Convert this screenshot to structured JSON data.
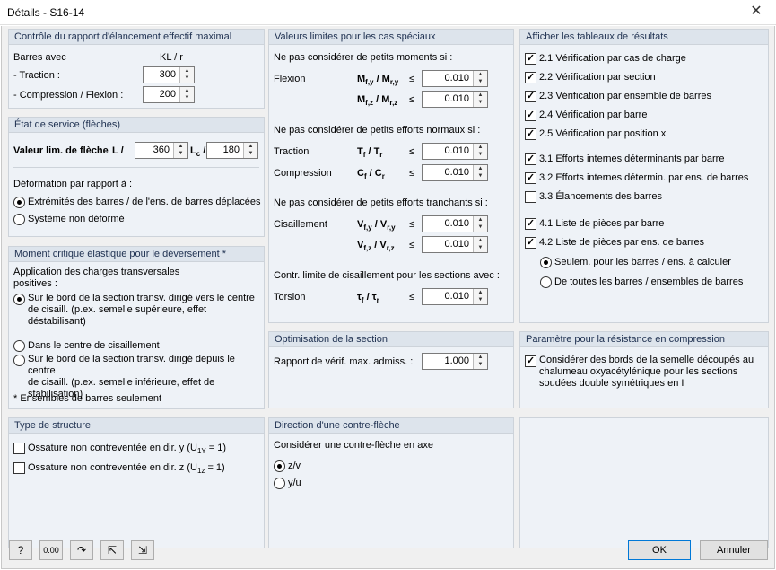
{
  "window": {
    "title": "Détails - S16-14",
    "close": "✕"
  },
  "slenderness": {
    "header": "Contrôle du rapport d'élancement effectif maximal",
    "col1": "Barres avec",
    "col2": "KL / r",
    "traction_label": "- Traction :",
    "traction_value": "300",
    "compression_label": "- Compression / Flexion :",
    "compression_value": "200"
  },
  "service": {
    "header": "État de service (flèches)",
    "limit_label": "Valeur lim. de flèche",
    "l_label": "L /",
    "l_value": "360",
    "lc_label": "L",
    "lc_sub": "c",
    "lc_slash": "/",
    "lc_value": "180",
    "deformation_label": "Déformation par rapport à :",
    "opt1": "Extrémités des barres / de l'ens. de barres déplacées",
    "opt2": "Système non déformé"
  },
  "moment": {
    "header": "Moment critique élastique pour le déversement *",
    "intro": "Application des charges transversales\npositives :",
    "opt1": "Sur le bord de la section transv. dirigé vers le centre\nde cisaill. (p.ex. semelle supérieure, effet\ndéstabilisant)",
    "opt2": "Dans le centre de cisaillement",
    "opt3": "Sur le bord de la section transv. dirigé depuis le centre\nde cisaill. (p.ex. semelle inférieure, effet de\nstabilisation)",
    "note": "* Ensembles de barres seulement"
  },
  "structure": {
    "header": "Type de structure",
    "opt1": "Ossature non contreventée en dir. y (U",
    "opt1_sub": "1Y",
    "opt1_end": " = 1)",
    "opt2": "Ossature non contreventée en dir. z (U",
    "opt2_sub": "1z",
    "opt2_end": " = 1)"
  },
  "limits": {
    "header": "Valeurs limites pour les cas spéciaux",
    "moments_title": "Ne pas considérer de petits moments si :",
    "flexion": "Flexion",
    "my_formula": "M",
    "my_sub1": "f,y",
    "my_mid": " / M",
    "my_sub2": "r,y",
    "my_value": "0.010",
    "mz_formula": "M",
    "mz_sub1": "f,z",
    "mz_mid": " / M",
    "mz_sub2": "r,z",
    "mz_value": "0.010",
    "normal_title": "Ne pas considérer de petits efforts normaux si :",
    "traction": "Traction",
    "t_formula": "T",
    "t_sub1": "f",
    "t_mid": " / T",
    "t_sub2": "r",
    "t_value": "0.010",
    "compression": "Compression",
    "c_formula": "C",
    "c_sub1": "f",
    "c_mid": " / C",
    "c_sub2": "r",
    "c_value": "0.010",
    "shear_title": "Ne pas considérer de petits efforts tranchants si :",
    "cisaillement": "Cisaillement",
    "vy_formula": "V",
    "vy_sub1": "f,y",
    "vy_mid": " / V",
    "vy_sub2": "r,y",
    "vy_value": "0.010",
    "vz_formula": "V",
    "vz_sub1": "f,z",
    "vz_mid": " / V",
    "vz_sub2": "r,z",
    "vz_value": "0.010",
    "torsion_title": "Contr. limite de cisaillement pour les sections avec :",
    "torsion": "Torsion",
    "tau_formula": "τ",
    "tau_sub1": "f",
    "tau_mid": " / τ",
    "tau_sub2": "r",
    "tau_value": "0.010",
    "le": "≤"
  },
  "optim": {
    "header": "Optimisation de la section",
    "label": "Rapport de vérif. max. admiss. :",
    "value": "1.000"
  },
  "camber": {
    "header": "Direction d'une contre-flèche",
    "label": "Considérer une contre-flèche en axe",
    "opt1": "z/v",
    "opt2": "y/u"
  },
  "results": {
    "header": "Afficher les tableaux de résultats",
    "items": [
      "2.1 Vérification par cas de charge",
      "2.2 Vérification par section",
      "2.3 Vérification par ensemble de barres",
      "2.4 Vérification par barre",
      "2.5 Vérification par position x",
      "3.1 Efforts internes déterminants par barre",
      "3.2 Efforts internes détermin. par ens. de barres",
      "3.3 Élancements des barres",
      "4.1 Liste de pièces par barre",
      "4.2 Liste de pièces par ens. de barres"
    ],
    "radio1": "Seulem. pour les barres / ens. à calculer",
    "radio2": "De toutes les barres / ensembles de barres"
  },
  "compression_param": {
    "header": "Paramètre pour la résistance en compression",
    "text": "Considérer des bords de la semelle découpés au\nchalumeau oxyacétylénique pour les sections\nsoudées double symétriques en I"
  },
  "footer": {
    "ok": "OK",
    "cancel": "Annuler",
    "units": "0.00"
  }
}
